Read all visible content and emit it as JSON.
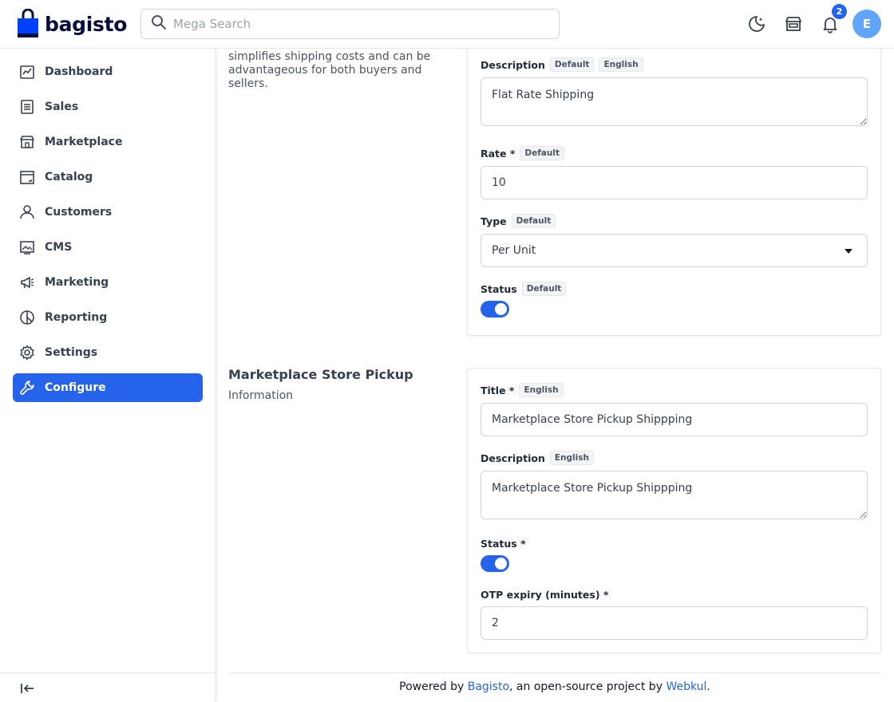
{
  "brand": {
    "name": "bagisto",
    "bag_color": "#0041ff"
  },
  "search": {
    "placeholder": "Mega Search"
  },
  "header": {
    "notification_count": "2",
    "avatar_initial": "E"
  },
  "sidebar": {
    "items": [
      {
        "label": "Dashboard",
        "icon": "dashboard-icon"
      },
      {
        "label": "Sales",
        "icon": "sales-icon"
      },
      {
        "label": "Marketplace",
        "icon": "store-icon"
      },
      {
        "label": "Catalog",
        "icon": "catalog-icon"
      },
      {
        "label": "Customers",
        "icon": "customers-icon"
      },
      {
        "label": "CMS",
        "icon": "cms-icon"
      },
      {
        "label": "Marketing",
        "icon": "marketing-icon"
      },
      {
        "label": "Reporting",
        "icon": "reporting-icon"
      },
      {
        "label": "Settings",
        "icon": "settings-icon"
      },
      {
        "label": "Configure",
        "icon": "configure-icon",
        "active": true
      }
    ]
  },
  "flat_rate": {
    "description_text": "simplifies shipping costs and can be advantageous for both buyers and sellers.",
    "description_label": "Description",
    "description_tags": [
      "Default",
      "English"
    ],
    "description_value": "Flat Rate Shipping",
    "rate_label": "Rate *",
    "rate_tag": "Default",
    "rate_value": "10",
    "type_label": "Type",
    "type_tag": "Default",
    "type_value": "Per Unit",
    "status_label": "Status",
    "status_tag": "Default",
    "status_on": true
  },
  "store_pickup": {
    "title": "Marketplace Store Pickup",
    "subtitle": "Information",
    "title_label": "Title *",
    "title_tag": "English",
    "title_value": "Marketplace Store Pickup Shippping",
    "description_label": "Description",
    "description_tag": "English",
    "description_value": "Marketplace Store Pickup Shippping",
    "status_label": "Status *",
    "status_on": true,
    "otp_label": "OTP expiry (minutes) *",
    "otp_value": "2"
  },
  "footer": {
    "prefix": "Powered by ",
    "link1": "Bagisto",
    "middle": ", an open-source project by ",
    "link2": "Webkul",
    "suffix": "."
  }
}
